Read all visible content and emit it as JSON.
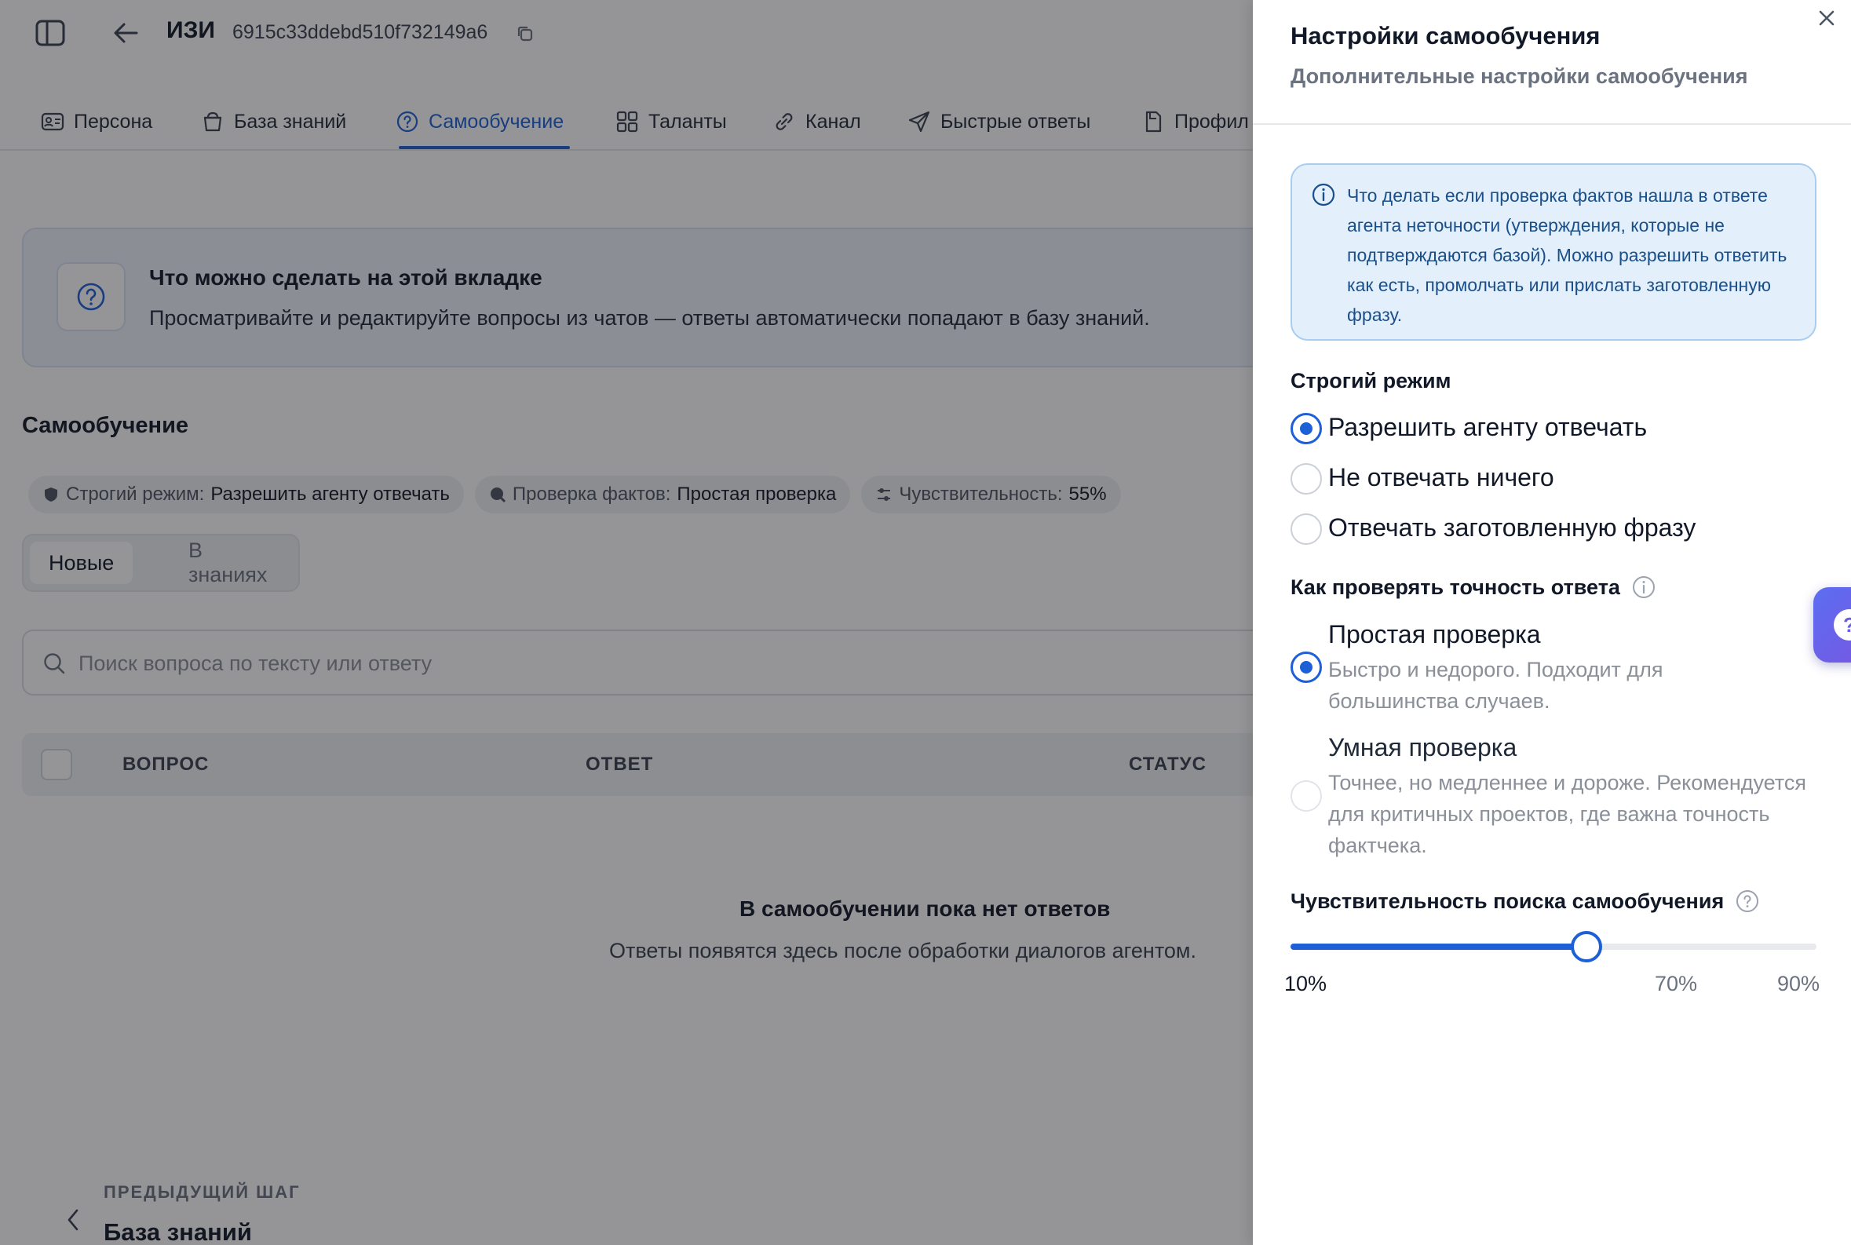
{
  "header": {
    "app_name": "ИЗИ",
    "agent_id": "6915c33ddebd510f732149a6"
  },
  "tabs": [
    {
      "label": "Персона",
      "icon": "id-card-icon"
    },
    {
      "label": "База знаний",
      "icon": "basket-icon"
    },
    {
      "label": "Самообучение",
      "icon": "question-circle-icon",
      "active": true
    },
    {
      "label": "Таланты",
      "icon": "grid-icon"
    },
    {
      "label": "Канал",
      "icon": "link-icon"
    },
    {
      "label": "Быстрые ответы",
      "icon": "send-icon"
    },
    {
      "label": "Профил",
      "icon": "document-icon"
    }
  ],
  "info_card": {
    "title": "Что можно сделать на этой вкладке",
    "description": "Просматривайте и редактируйте вопросы из чатов — ответы автоматически попадают в базу знаний."
  },
  "section_title": "Самообучение",
  "chips": [
    {
      "key": "Строгий режим:",
      "value": "Разрешить агенту отвечать",
      "icon": "shield-icon"
    },
    {
      "key": "Проверка фактов:",
      "value": "Простая проверка",
      "icon": "search-bubble-icon"
    },
    {
      "key": "Чувствительность:",
      "value": "55%",
      "icon": "sliders-icon"
    }
  ],
  "segments": {
    "active": "Новые",
    "inactive": "В знаниях"
  },
  "search": {
    "placeholder": "Поиск вопроса по тексту или ответу",
    "value": ""
  },
  "table": {
    "columns": [
      "ВОПРОС",
      "ОТВЕТ",
      "СТАТУС"
    ]
  },
  "empty_state": {
    "title": "В самообучении пока нет ответов",
    "subtitle": "Ответы появятся здесь после обработки диалогов агентом."
  },
  "prev_step": {
    "label": "ПРЕДЫДУЩИЙ ШАГ",
    "name": "База знаний"
  },
  "drawer": {
    "title": "Настройки самообучения",
    "subtitle": "Дополнительные настройки самообучения",
    "alert": "Что делать если проверка фактов нашла в ответе агента неточности (утверждения, которые не подтверждаются базой). Можно разрешить ответить как есть, промолчать или прислать заготовленную фразу.",
    "strict_mode": {
      "title": "Строгий режим",
      "options": [
        "Разрешить агенту отвечать",
        "Не отвечать ничего",
        "Отвечать заготовленную фразу"
      ],
      "selected": 0
    },
    "check_mode": {
      "title": "Как проверять точность ответа",
      "options": [
        {
          "title": "Простая проверка",
          "desc": "Быстро и недорого. Подходит для большинства случаев."
        },
        {
          "title": "Умная проверка",
          "desc": "Точнее, но медленнее и дороже. Рекомендуется для критичных проектов, где важна точность фактчека."
        }
      ],
      "selected": 0
    },
    "sensitivity": {
      "title": "Чувствительность поиска самообучения",
      "value_percent": 55,
      "min_percent": 10,
      "max_percent": 90,
      "labels": [
        "10%",
        "70%",
        "90%"
      ]
    }
  },
  "colors": {
    "accent": "#1d5fd6",
    "alert_bg": "#e3f0fb",
    "fab": "#6a5be6"
  }
}
